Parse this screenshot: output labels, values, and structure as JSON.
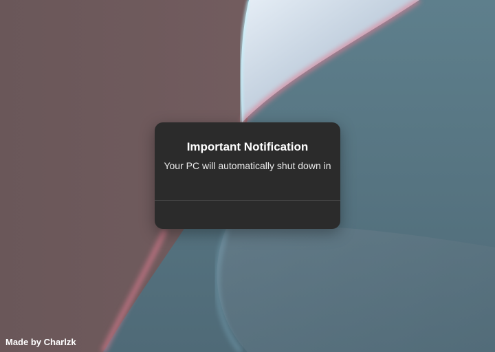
{
  "wallpaper": {
    "left_color": "#6d5a5c",
    "right_color": "#587683",
    "light_color": "#c9d3e0",
    "edge_glow_pink": "#e07d92",
    "edge_glow_cyan": "#bff4ff"
  },
  "dialog": {
    "title": "Important Notification",
    "message": "Your PC will automatically shut down in",
    "background": "#2b2b2b"
  },
  "footer": {
    "credit": "Made by Charlzk"
  }
}
